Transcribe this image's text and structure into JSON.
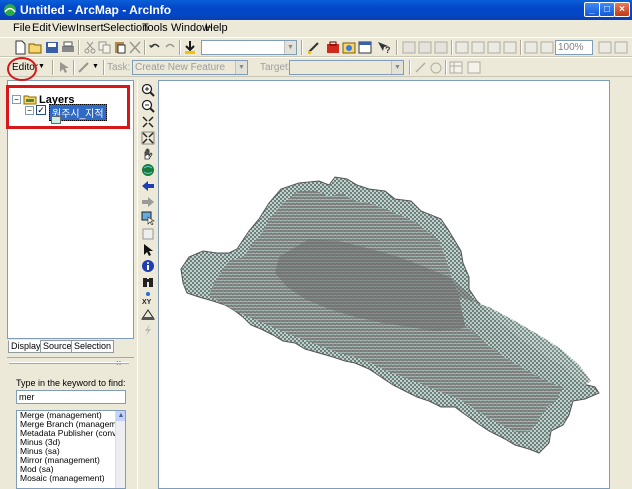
{
  "window": {
    "title": "Untitled - ArcMap - ArcInfo",
    "minimize": "_",
    "maximize": "□",
    "close": "×"
  },
  "menu": [
    "File",
    "Edit",
    "View",
    "Insert",
    "Selection",
    "Tools",
    "Window",
    "Help"
  ],
  "standard_toolbar": {
    "scale_value": "",
    "zoom_value": "100%"
  },
  "editor_toolbar": {
    "editor_label": "Editor",
    "task_label": "Task:",
    "task_value": "Create New Feature",
    "target_label": "Target:",
    "target_value": ""
  },
  "toc": {
    "root_label": "Layers",
    "layer_name": "원주시_지적",
    "tabs": [
      "Display",
      "Source",
      "Selection"
    ]
  },
  "search": {
    "prompt": "Type in the keyword to find:",
    "value": "mer",
    "results": [
      "Merge (management)",
      "Merge Branch (management)",
      "Metadata Publisher (conversion)",
      "Minus (3d)",
      "Minus (sa)",
      "Mirror (management)",
      "Mod (sa)",
      "Mosaic (management)"
    ]
  },
  "colors": {
    "title_bar": "#0346c8",
    "parcel_fill": "#c8f0e6",
    "parcel_line": "#666666",
    "annotation": "#d81818"
  },
  "icons": {
    "tools": [
      "zoom-in-icon",
      "zoom-out-icon",
      "fixed-zoom-in-icon",
      "fixed-zoom-out-icon",
      "pan-icon",
      "full-extent-icon",
      "back-extent-icon",
      "forward-extent-icon",
      "select-features-icon",
      "select-elements-icon",
      "arrow-icon",
      "identify-icon",
      "find-icon",
      "go-to-xy-icon",
      "measure-icon",
      "hyperlink-icon"
    ]
  }
}
